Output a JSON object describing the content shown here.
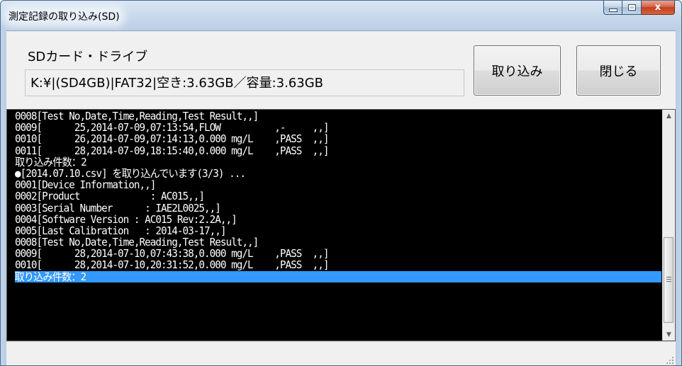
{
  "window": {
    "title": "測定記録の取り込み(SD)",
    "caption_icons": [
      "minimize-icon",
      "maximize-icon",
      "close-icon"
    ],
    "close_glyph": "x"
  },
  "drive_section": {
    "label": "SDカード・ドライブ",
    "drive_info": "K:¥|(SD4GB)|FAT32|空き:3.63GB／容量:3.63GB"
  },
  "buttons": {
    "import_label": "取り込み",
    "close_label": "閉じる"
  },
  "log": {
    "lines": [
      "0008[Test No,Date,Time,Reading,Test Result,,]",
      "0009[      25,2014-07-09,07:13:54,FLOW          ,-     ,,]",
      "0010[      26,2014-07-09,07:14:13,0.000 mg/L    ,PASS  ,,]",
      "0011[      28,2014-07-09,18:15:40,0.000 mg/L    ,PASS  ,,]",
      "取り込み件数：2",
      "●[2014.07.10.csv] を取り込んでいます(3/3) ...",
      "0001[Device Information,,]",
      "0002[Product             : AC015,,]",
      "0003[Serial Number      : IAE2L0025,,]",
      "0004[Software Version : AC015 Rev:2.2A,,]",
      "0005[Last Calibration   : 2014-03-17,,]",
      "0008[Test No,Date,Time,Reading,Test Result,,]",
      "0009[      28,2014-07-10,07:43:38,0.000 mg/L    ,PASS  ,,]",
      "0010[      28,2014-07-10,20:31:52,0.000 mg/L    ,PASS  ,,]",
      "取り込み件数：2"
    ],
    "selected_index": 14,
    "scroll_position": 0.9,
    "colors": {
      "background": "#000000",
      "text": "#ffffff",
      "selection": "#3399ff"
    }
  },
  "statusbar": {
    "text": ""
  }
}
